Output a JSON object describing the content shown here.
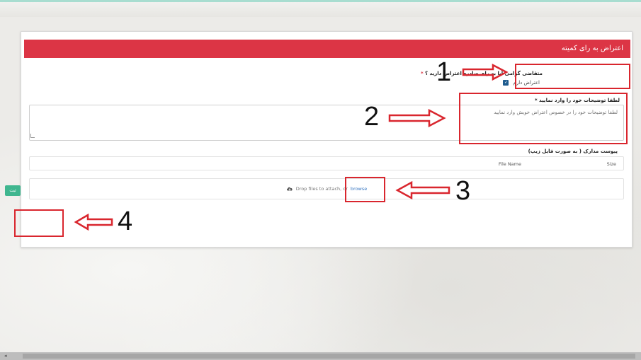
{
  "form": {
    "title": "اعتراض به رای کمیته",
    "question_label": "متقاضی گرامی آیا به رای صادره اعتراض دارید ؟",
    "question_required_mark": "*",
    "checkbox_label": "اعتراض دارم",
    "checkbox_checked": true,
    "description_label": "لطفا توضیحات خود را وارد نمایید *",
    "description_placeholder": "لطفا توضیحات خود را در خصوص اعتراض خویش وارد نمایید",
    "attachment_label": "پیوست مدارک ( به صورت فایل زیپ)",
    "table_headers": [
      "Size",
      "File Name"
    ],
    "dropzone_text": "Drop files to attach, or",
    "browse_label": "browse",
    "submit_label": "ثبت"
  },
  "annotations": {
    "numbers": [
      "1",
      "2",
      "3",
      "4"
    ],
    "color": "#d9262e"
  },
  "colors": {
    "header_red": "#dc3545",
    "submit_green": "#3fb68f",
    "checkbox_blue": "#1f5c8f",
    "link_blue": "#3a78c2"
  },
  "icons": [
    "cloud-upload-icon",
    "arrow-left-icon",
    "arrow-right-icon",
    "checkbox-check-icon"
  ]
}
